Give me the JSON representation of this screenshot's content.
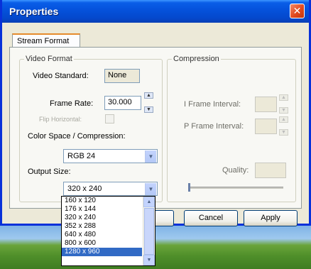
{
  "window": {
    "title": "Properties",
    "close_glyph": "✕"
  },
  "tab": {
    "label": "Stream Format"
  },
  "video_format": {
    "group_label": "Video Format",
    "video_standard_label": "Video Standard:",
    "video_standard_value": "None",
    "frame_rate_label": "Frame Rate:",
    "frame_rate_value": "30.000",
    "flip_horizontal_label": "Flip Horizontal:",
    "color_space_label": "Color Space / Compression:",
    "color_space_value": "RGB 24",
    "output_size_label": "Output Size:",
    "output_size_value": "320 x 240"
  },
  "compression": {
    "group_label": "Compression",
    "i_frame_label": "I Frame Interval:",
    "p_frame_label": "P Frame Interval:",
    "quality_label": "Quality:"
  },
  "buttons": {
    "cancel": "Cancel",
    "apply": "Apply"
  },
  "output_size_options": [
    "160 x 120",
    "176 x 144",
    "320 x 240",
    "352 x 288",
    "640 x 480",
    "800 x 600",
    "1280 x 960"
  ],
  "selected_option_index": 6,
  "colors": {
    "title_bar": "#0553dd",
    "selection": "#316ac5",
    "close_button": "#e2491e"
  }
}
